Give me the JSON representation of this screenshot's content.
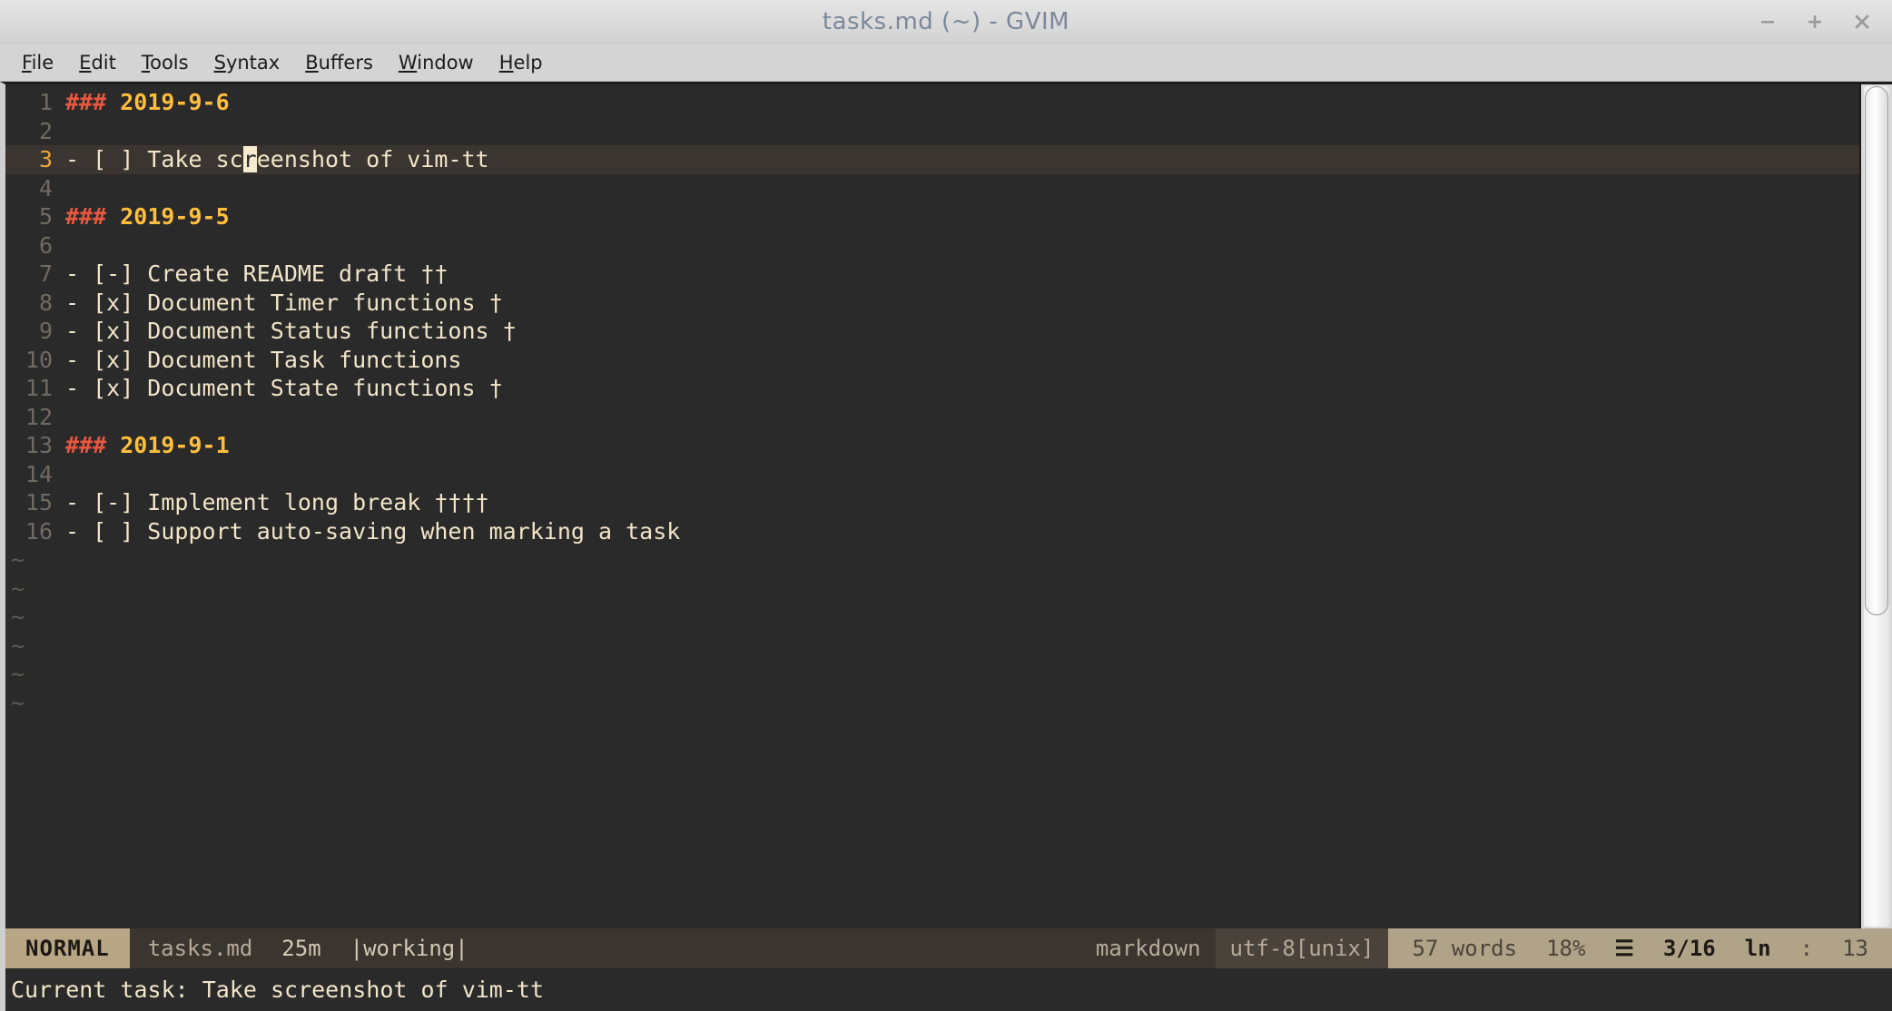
{
  "window": {
    "title": "tasks.md (~) - GVIM",
    "controls": [
      {
        "name": "minimize-button",
        "glyph": "minimize"
      },
      {
        "name": "maximize-button",
        "glyph": "maximize"
      },
      {
        "name": "close-button",
        "glyph": "close"
      }
    ]
  },
  "menubar": {
    "items": [
      {
        "label": "File",
        "mnemonic": "F"
      },
      {
        "label": "Edit",
        "mnemonic": "E"
      },
      {
        "label": "Tools",
        "mnemonic": "T"
      },
      {
        "label": "Syntax",
        "mnemonic": "S"
      },
      {
        "label": "Buffers",
        "mnemonic": "B"
      },
      {
        "label": "Window",
        "mnemonic": "W"
      },
      {
        "label": "Help",
        "mnemonic": "H"
      }
    ]
  },
  "editor": {
    "filetype_colors": {
      "background": "#2a2a2a",
      "cursorline": "#3a3530",
      "text": "#f2e5c8",
      "heading_hash": "#e8573f",
      "heading_text": "#ffbe3d",
      "linenr": "#6f6a62",
      "cursorlinenr": "#e8a33d",
      "cursor": "#f6ecd0"
    },
    "lines": [
      {
        "num": "1",
        "type": "heading",
        "hash": "###",
        "text": "2019-9-6"
      },
      {
        "num": "2",
        "type": "blank",
        "text": ""
      },
      {
        "num": "3",
        "type": "task",
        "text": "- [ ] Take screenshot of vim-tt",
        "cursorline": true,
        "cursor_col": 13
      },
      {
        "num": "4",
        "type": "blank",
        "text": ""
      },
      {
        "num": "5",
        "type": "heading",
        "hash": "###",
        "text": "2019-9-5"
      },
      {
        "num": "6",
        "type": "blank",
        "text": ""
      },
      {
        "num": "7",
        "type": "task",
        "text": "- [-] Create README draft ††"
      },
      {
        "num": "8",
        "type": "task",
        "text": "- [x] Document Timer functions †"
      },
      {
        "num": "9",
        "type": "task",
        "text": "- [x] Document Status functions †"
      },
      {
        "num": "10",
        "type": "task",
        "text": "- [x] Document Task functions"
      },
      {
        "num": "11",
        "type": "task",
        "text": "- [x] Document State functions †"
      },
      {
        "num": "12",
        "type": "blank",
        "text": ""
      },
      {
        "num": "13",
        "type": "heading",
        "hash": "###",
        "text": "2019-9-1"
      },
      {
        "num": "14",
        "type": "blank",
        "text": ""
      },
      {
        "num": "15",
        "type": "task",
        "text": "- [-] Implement long break ††††"
      },
      {
        "num": "16",
        "type": "task",
        "text": "- [ ] Support auto-saving when marking a task"
      }
    ],
    "filler_tildes": [
      "~",
      "~",
      "~",
      "~",
      "~",
      "~"
    ]
  },
  "scrollbar": {
    "thumb_top_percent": 0,
    "thumb_height_percent": 63
  },
  "statusline": {
    "mode": "NORMAL",
    "filename": "tasks.md",
    "timer": "25m",
    "timer_state": "|working|",
    "filetype": "markdown",
    "encoding": "utf-8[unix]",
    "words": "57 words",
    "percent": "18%",
    "percent_icon": "☰",
    "position": "3/16",
    "line_icon": "㏑",
    "colon": ":",
    "column": "13",
    "colors": {
      "mode_bg": "#b8a684",
      "right_bg": "#b1a388",
      "mid_bg": "#3b352f",
      "enc_bg": "#4a433b"
    }
  },
  "cmdline": {
    "message": "Current task: Take screenshot of vim-tt"
  }
}
